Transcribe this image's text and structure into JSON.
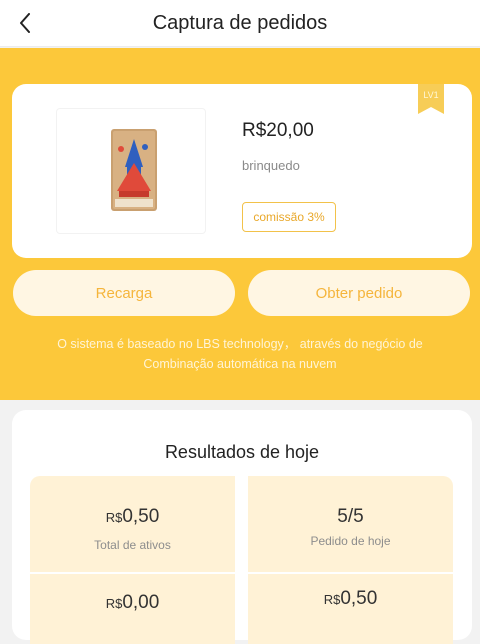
{
  "header": {
    "title": "Captura de pedidos",
    "back_icon": "chevron-left-icon"
  },
  "product": {
    "price": "R$20,00",
    "category": "brinquedo",
    "commission": "comissão 3%",
    "level_badge": "LV1",
    "image_icon": "toy-rocket-box-image"
  },
  "actions": {
    "recharge_label": "Recarga",
    "get_order_label": "Obter pedido"
  },
  "info_lines": [
    "O sistema é baseado no LBS technology， através do negócio de",
    "Combinação automática na nuvem"
  ],
  "results": {
    "title": "Resultados de hoje",
    "stats": [
      {
        "currency": "R$",
        "value": "0,50",
        "label": "Total de ativos"
      },
      {
        "currency": "",
        "value": "5/5",
        "label": "Pedido de hoje"
      },
      {
        "currency": "R$",
        "value": "0,00",
        "label": ""
      },
      {
        "currency": "R$",
        "value": "0,50",
        "label": ""
      }
    ]
  },
  "colors": {
    "accent": "#fcc83a",
    "button_text": "#f5b53c",
    "stat_bg": "#fff2d6"
  }
}
